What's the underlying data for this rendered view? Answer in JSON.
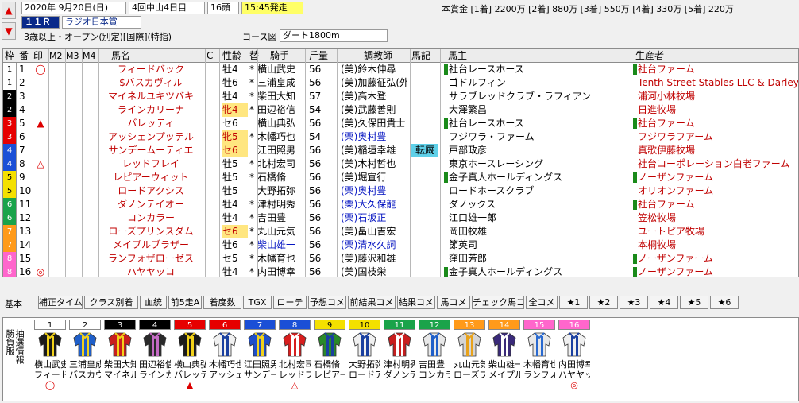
{
  "header": {
    "date": "2020年 9月20日(日)",
    "meeting": "4回中山4日目",
    "runners": "16頭",
    "post_time": "15:45発走",
    "race_no": "１１Ｒ",
    "race_name": "ラジオ日本賞",
    "conditions": "3歳以上・オープン(別定)[国際](特指)",
    "course_label": "コース図",
    "course": "ダート1800m",
    "prize": "本賞金 [1着] 2200万 [2着] 880万 [3着] 550万 [4着] 330万 [5着] 220万"
  },
  "columns": {
    "waku": "枠",
    "ban": "番",
    "mark": "印",
    "m2": "M2",
    "m3": "M3",
    "m4": "M4",
    "name": "馬名",
    "c": "C",
    "sexage": "性齢",
    "change": "替",
    "jockey": "騎手",
    "weight": "斤量",
    "trainer": "調教師",
    "note": "馬記",
    "owner": "馬主",
    "breeder": "生産者"
  },
  "rows": [
    {
      "waku": "1",
      "ban": "1",
      "mark": "◯",
      "name": "フィードバック",
      "sexage": "牡4",
      "change": "*",
      "jockey": "横山武史",
      "weight": "56",
      "trainer": "(美)鈴木伸尋",
      "note": "",
      "owner_flag": true,
      "owner": "社台レースホース",
      "breeder_flag": true,
      "breeder": "社台ファーム"
    },
    {
      "waku": "1",
      "ban": "2",
      "mark": "",
      "name": "$バスカヴィル",
      "sexage": "牡6",
      "change": "*",
      "jockey": "三浦皇成",
      "weight": "56",
      "trainer": "(美)加藤征弘",
      "trainer_extra": "(外)",
      "note": "",
      "owner_flag": false,
      "owner": "ゴドルフィン",
      "breeder_flag": false,
      "breeder": "Tenth Street Stables LLC & Darley"
    },
    {
      "waku": "2",
      "ban": "3",
      "mark": "",
      "name": "マイネルユキツバキ",
      "sexage": "牡4",
      "change": "*",
      "jockey": "柴田大知",
      "weight": "57",
      "trainer": "(美)高木登",
      "note": "",
      "owner_flag": false,
      "owner": "サラブレッドクラブ・ラフィアン",
      "breeder_flag": false,
      "breeder": "浦河小林牧場"
    },
    {
      "waku": "2",
      "ban": "4",
      "mark": "",
      "name": "ラインカリーナ",
      "sexage": "牝4",
      "change": "*",
      "jockey": "田辺裕信",
      "weight": "54",
      "trainer": "(美)武藤善則",
      "note": "",
      "owner_flag": false,
      "owner": "大澤繁昌",
      "breeder_flag": false,
      "breeder": "日進牧場"
    },
    {
      "waku": "3",
      "ban": "5",
      "mark": "▲",
      "name": "バレッティ",
      "sexage": "セ6",
      "change": "",
      "jockey": "横山典弘",
      "weight": "56",
      "trainer": "(美)久保田貴",
      "trainer_extra": "士",
      "note": "",
      "owner_flag": true,
      "owner": "社台レースホース",
      "breeder_flag": true,
      "breeder": "社台ファーム"
    },
    {
      "waku": "3",
      "ban": "6",
      "mark": "",
      "name": "アッシェンプッテル",
      "sexage": "牝5",
      "change": "*",
      "jockey": "木幡巧也",
      "weight": "54",
      "trainer": "(栗)奥村豊",
      "note": "",
      "owner_flag": false,
      "owner": "フジワラ・ファーム",
      "breeder_flag": false,
      "breeder": "フジワラフアーム"
    },
    {
      "waku": "4",
      "ban": "7",
      "mark": "",
      "name": "サンデームーティエ",
      "sexage": "セ6",
      "change": "",
      "jockey": "江田照男",
      "weight": "56",
      "trainer": "(美)稲垣幸雄",
      "note": "転厩",
      "owner_flag": false,
      "owner": "戸部政彦",
      "breeder_flag": false,
      "breeder": "真歌伊藤牧場"
    },
    {
      "waku": "4",
      "ban": "8",
      "mark": "△",
      "name": "レッドフレイ",
      "sexage": "牡5",
      "change": "*",
      "jockey": "北村宏司",
      "weight": "56",
      "trainer": "(美)木村哲也",
      "note": "",
      "owner_flag": false,
      "owner": "東京ホースレーシング",
      "breeder_flag": false,
      "breeder": "社台コーポレーション白老ファーム"
    },
    {
      "waku": "5",
      "ban": "9",
      "mark": "",
      "name": "レピアーウィット",
      "sexage": "牡5",
      "change": "*",
      "jockey": "石橋脩",
      "weight": "56",
      "trainer": "(美)堀宣行",
      "note": "",
      "owner_flag": true,
      "owner": "金子真人ホールディングス",
      "breeder_flag": true,
      "breeder": "ノーザンファーム"
    },
    {
      "waku": "5",
      "ban": "10",
      "mark": "",
      "name": "ロードアクシス",
      "sexage": "牡5",
      "change": "",
      "jockey": "大野拓弥",
      "weight": "56",
      "trainer": "(栗)奥村豊",
      "note": "",
      "owner_flag": false,
      "owner": "ロードホースクラブ",
      "breeder_flag": false,
      "breeder": "オリオンファーム"
    },
    {
      "waku": "6",
      "ban": "11",
      "mark": "",
      "name": "ダノンテイオー",
      "sexage": "牡4",
      "change": "*",
      "jockey": "津村明秀",
      "weight": "56",
      "trainer": "(栗)大久保龍",
      "note": "",
      "owner_flag": false,
      "owner": "ダノックス",
      "breeder_flag": true,
      "breeder": "社台ファーム"
    },
    {
      "waku": "6",
      "ban": "12",
      "mark": "",
      "name": "コンカラー",
      "sexage": "牡4",
      "change": "*",
      "jockey": "吉田豊",
      "weight": "56",
      "trainer": "(栗)石坂正",
      "note": "",
      "owner_flag": false,
      "owner": "江口雄一郎",
      "breeder_flag": false,
      "breeder": "笠松牧場"
    },
    {
      "waku": "7",
      "ban": "13",
      "mark": "",
      "name": "ローズプリンスダム",
      "sexage": "セ6",
      "change": "*",
      "jockey": "丸山元気",
      "weight": "56",
      "trainer": "(美)畠山吉宏",
      "note": "",
      "owner_flag": false,
      "owner": "岡田牧雄",
      "breeder_flag": false,
      "breeder": "ユートピア牧場"
    },
    {
      "waku": "7",
      "ban": "14",
      "mark": "",
      "name": "メイプルブラザー",
      "sexage": "牡6",
      "change": "*",
      "jockey": "柴山雄一",
      "weight": "56",
      "trainer": "(栗)清水久詞",
      "note": "",
      "owner_flag": false,
      "owner": "節英司",
      "breeder_flag": false,
      "breeder": "本桐牧場"
    },
    {
      "waku": "8",
      "ban": "15",
      "mark": "",
      "name": "ランフォザローゼス",
      "sexage": "セ5",
      "change": "*",
      "jockey": "木幡育也",
      "weight": "56",
      "trainer": "(美)藤沢和雄",
      "note": "",
      "owner_flag": false,
      "owner": "窪田芳郎",
      "breeder_flag": true,
      "breeder": "ノーザンファーム"
    },
    {
      "waku": "8",
      "ban": "16",
      "mark": "◎",
      "name": "ハヤヤッコ",
      "sexage": "牡4",
      "change": "*",
      "jockey": "内田博幸",
      "weight": "56",
      "trainer": "(美)国枝栄",
      "note": "",
      "owner_flag": true,
      "owner": "金子真人ホールディングス",
      "breeder_flag": true,
      "breeder": "ノーザンファーム"
    }
  ],
  "toolbar": {
    "label": "基本",
    "buttons": [
      "補正タイム",
      "クラス別着",
      "血統",
      "前5走A",
      "着度数",
      "TGX",
      "ローテ",
      "予想コメ",
      "前結果コメ",
      "結果コメ",
      "馬コメ",
      "チェック馬コメ",
      "全コメ",
      "★1",
      "★2",
      "★3",
      "★4",
      "★5",
      "★6"
    ]
  },
  "silks_panel": {
    "side_label": "勝負服",
    "side_label2": "抽選情報",
    "horses": [
      {
        "num": "1",
        "jockey": "横山武史",
        "horse": "フィードバック",
        "mark": "◯"
      },
      {
        "num": "2",
        "jockey": "三浦皇成",
        "horse": "バスカヴィル",
        "mark": ""
      },
      {
        "num": "3",
        "jockey": "柴田大知",
        "horse": "マイネルユキ",
        "mark": ""
      },
      {
        "num": "4",
        "jockey": "田辺裕信",
        "horse": "ラインカリーナ",
        "mark": ""
      },
      {
        "num": "5",
        "jockey": "横山典弘",
        "horse": "バレッティ",
        "mark": "▲"
      },
      {
        "num": "6",
        "jockey": "木幡巧也",
        "horse": "アッシェンプ",
        "mark": ""
      },
      {
        "num": "7",
        "jockey": "江田照男",
        "horse": "サンデーム",
        "mark": ""
      },
      {
        "num": "8",
        "jockey": "北村宏司",
        "horse": "レッドフレイ",
        "mark": "△"
      },
      {
        "num": "9",
        "jockey": "石橋脩",
        "horse": "レピアーウ",
        "mark": ""
      },
      {
        "num": "10",
        "jockey": "大野拓弥",
        "horse": "ロードアク",
        "mark": ""
      },
      {
        "num": "11",
        "jockey": "津村明秀",
        "horse": "ダノンテイオ",
        "mark": ""
      },
      {
        "num": "12",
        "jockey": "吉田豊",
        "horse": "コンカラー",
        "mark": ""
      },
      {
        "num": "13",
        "jockey": "丸山元気",
        "horse": "ローズプリ",
        "mark": ""
      },
      {
        "num": "14",
        "jockey": "柴山雄一",
        "horse": "メイプルブ",
        "mark": ""
      },
      {
        "num": "15",
        "jockey": "木幡育也",
        "horse": "ランフォザ",
        "mark": ""
      },
      {
        "num": "16",
        "jockey": "内田博幸",
        "horse": "ハヤヤッコ",
        "mark": "◎"
      }
    ]
  },
  "colors": {
    "waku": {
      "1": "#ffffff",
      "2": "#000000",
      "3": "#e60000",
      "4": "#1a4fd6",
      "5": "#f4e000",
      "6": "#1aa34a",
      "7": "#ff9a1a",
      "8": "#ff66cc"
    },
    "waku_text": {
      "1": "#000000",
      "2": "#ffffff",
      "3": "#ffffff",
      "4": "#ffffff",
      "5": "#000000",
      "6": "#ffffff",
      "7": "#ffffff",
      "8": "#ffffff"
    },
    "silk_body": [
      "#1a1a1a",
      "#1f5fc9",
      "#c81e1e",
      "#2a2a2a",
      "#1a1a1a",
      "#f0f0f0",
      "#1f4fc9",
      "#d81e1e",
      "#2a8a2a",
      "#f0f0f0",
      "#c81e1e",
      "#e8e8e8",
      "#d5d5d5",
      "#3a2a7a",
      "#e8e8e8",
      "#f0f0f0"
    ],
    "silk_accent": [
      "#f2d21a",
      "#f2d21a",
      "#f2d21a",
      "#c56ac5",
      "#f2d21a",
      "#1a3fa0",
      "#f2d21a",
      "#ffffff",
      "#1a3fa0",
      "#1a3fa0",
      "#ffffff",
      "#1f5fc9",
      "#e8a21a",
      "#ffffff",
      "#2a6ad0",
      "#1a3fa0"
    ]
  }
}
